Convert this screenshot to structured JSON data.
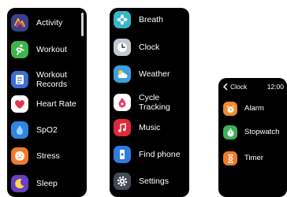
{
  "screen1": {
    "items": [
      {
        "label": "Activity",
        "icon": "activity-icon",
        "color": "#3b3f8f"
      },
      {
        "label": "Workout",
        "icon": "running-icon",
        "color": "#3fb44a"
      },
      {
        "label": "Workout\nRecords",
        "icon": "records-icon",
        "color": "#3d6fd6"
      },
      {
        "label": "Heart Rate",
        "icon": "heart-icon",
        "color": "#ffffff"
      },
      {
        "label": "SpO2",
        "icon": "drop-icon",
        "color": "#2f86e0"
      },
      {
        "label": "Stress",
        "icon": "stress-icon",
        "color": "#f07a2b"
      },
      {
        "label": "Sleep",
        "icon": "moon-icon",
        "color": "#6a3fc2"
      }
    ]
  },
  "screen2": {
    "items": [
      {
        "label": "Breath",
        "icon": "flower-icon",
        "color": "#37b7c7"
      },
      {
        "label": "Clock",
        "icon": "clock-icon",
        "color": "#bfc7d2"
      },
      {
        "label": "Weather",
        "icon": "weather-icon",
        "color": "#3aa0e0"
      },
      {
        "label": "Cycle\nTracking",
        "icon": "cycle-icon",
        "color": "#ffffff"
      },
      {
        "label": "Music",
        "icon": "music-icon",
        "color": "#e02a3a"
      },
      {
        "label": "Find phone",
        "icon": "find-phone-icon",
        "color": "#2f7be0"
      },
      {
        "label": "Settings",
        "icon": "gear-icon",
        "color": "#444a55"
      }
    ]
  },
  "screen3": {
    "header": {
      "title": "Clock",
      "time": "12:00"
    },
    "items": [
      {
        "label": "Alarm",
        "icon": "alarm-icon",
        "color": "#f08a2b"
      },
      {
        "label": "Stopwatch",
        "icon": "stopwatch-icon",
        "color": "#3fae5a"
      },
      {
        "label": "Timer",
        "icon": "hourglass-icon",
        "color": "#f07a2b"
      }
    ]
  }
}
